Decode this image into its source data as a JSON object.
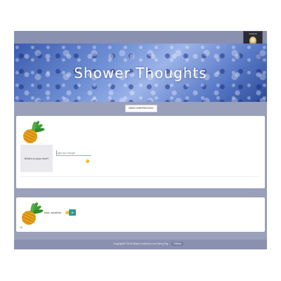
{
  "header": {
    "avatar_caption": "VizQuick"
  },
  "banner": {
    "title": "Shower Thoughts"
  },
  "actions": {
    "inspire_label": "NEED INSPIRATION?"
  },
  "composer": {
    "prompt_label": "What's on your mind?",
    "input_placeholder": "type your thought"
  },
  "feed": {
    "items": [
      {
        "text": "hello, sunshine",
        "send_label": "➤",
        "count": "12"
      }
    ]
  },
  "footer": {
    "copyright": "Copyright© 2019 Allison Anderson and Jenny Ng",
    "link_label": "GitHub"
  },
  "colors": {
    "frame": "#9a9fba",
    "bar": "#8a90b0",
    "teal": "#2e9a90"
  },
  "icons": {
    "pineapple": "pineapple-icon",
    "emoji": "emoji-icon",
    "bulb": "lightbulb-icon"
  }
}
